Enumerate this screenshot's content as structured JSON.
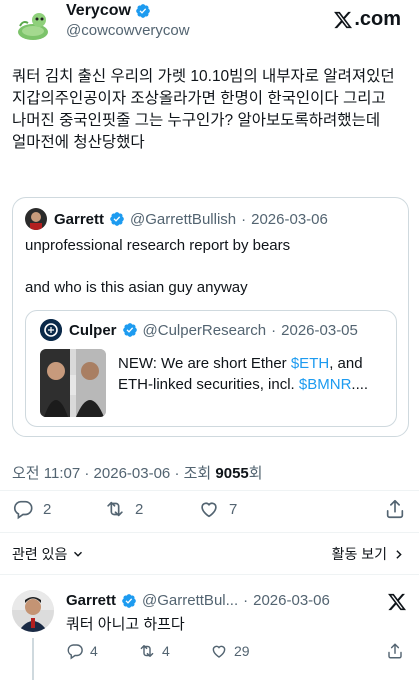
{
  "post": {
    "author_name": "Verycow",
    "author_handle": "@cowcowverycow",
    "brand": ".com",
    "text": "쿼터 김치 출신 우리의 가렛 10.10빔의 내부자로 알려져있던 지갑의주인공이자 조상올라가면 한명이 한국인이다 그리고 나머진 중국인핏줄 그는 누구인가? 알아보도록하려했는데 얼마전에 청산당했다",
    "time": "오전 11:07",
    "date": "2026-03-06",
    "views_label": "조회",
    "views_count": "9055",
    "views_suffix": "회",
    "sep": "·"
  },
  "quote": {
    "name": "Garrett",
    "handle": "@GarrettBullish",
    "sep": "·",
    "date": "2026-03-06",
    "line1": "unprofessional research report by bears",
    "line2": "and who is this asian guy anyway"
  },
  "inner": {
    "name": "Culper",
    "handle": "@CulperResearch",
    "sep": "·",
    "date": "2026-03-05",
    "text_a": "NEW: We are short Ether ",
    "link_a": "$ETH",
    "text_b": ", and ETH-linked securities, incl. ",
    "link_b": "$BMNR",
    "text_c": "...."
  },
  "actions": {
    "replies": "2",
    "retweets": "2",
    "likes": "7"
  },
  "related": {
    "left_label": "관련 있음",
    "right_label": "활동 보기"
  },
  "reply": {
    "name": "Garrett",
    "handle": "@GarrettBul...",
    "sep": "·",
    "date": "2026-03-06",
    "text": "쿼터 아니고 하프다",
    "replies": "4",
    "retweets": "4",
    "likes": "29"
  },
  "colors": {
    "verified": "#1d9bf0",
    "muted": "#536471",
    "link": "#1d9bf0",
    "border": "#cfd9de"
  },
  "icons": [
    "verified-badge-icon",
    "x-logo-icon",
    "reply-icon",
    "retweet-icon",
    "like-icon",
    "share-icon",
    "chevron-down-icon",
    "chevron-right-icon"
  ]
}
